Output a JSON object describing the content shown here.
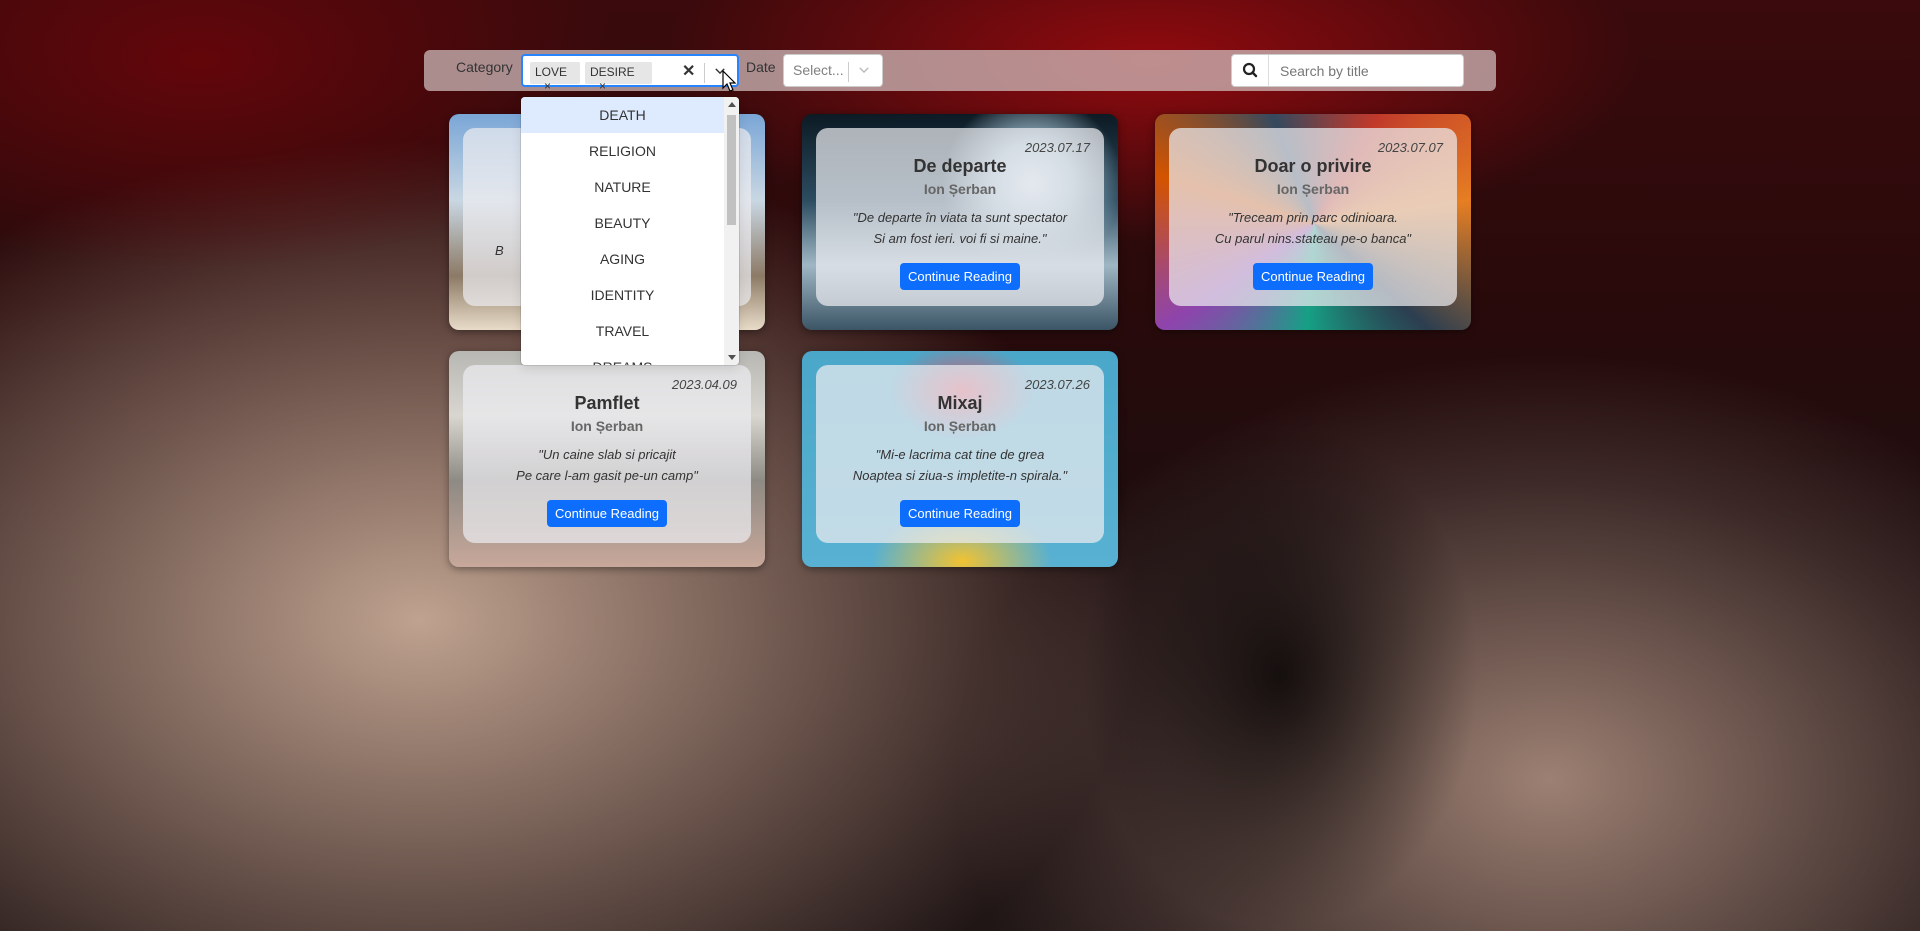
{
  "filters": {
    "category_label": "Category",
    "selected_chips": [
      {
        "label": "LOVE",
        "remove": "×"
      },
      {
        "label": "DESIRE",
        "remove": "×"
      }
    ],
    "clear_symbol": "✕",
    "date_label": "Date",
    "date_placeholder": "Select...",
    "search_placeholder": "Search by title"
  },
  "dropdown": {
    "options": [
      "DEATH",
      "RELIGION",
      "NATURE",
      "BEAUTY",
      "AGING",
      "IDENTITY",
      "TRAVEL",
      "DREAMS"
    ],
    "highlighted": "DEATH"
  },
  "cards": [
    {
      "title": "",
      "author": "",
      "date": "",
      "quote_line1": "",
      "quote_line2": "B",
      "button": ""
    },
    {
      "title": "De departe",
      "author": "Ion Șerban",
      "date": "2023.07.17",
      "quote_line1": "\"De departe în viata ta sunt spectator",
      "quote_line2": "Si am fost ieri. voi fi si maine.\"",
      "button": "Continue Reading"
    },
    {
      "title": "Doar o privire",
      "author": "Ion Șerban",
      "date": "2023.07.07",
      "quote_line1": "\"Treceam prin parc odinioara.",
      "quote_line2": "Cu parul nins.stateau pe-o banca\"",
      "button": "Continue Reading"
    },
    {
      "title": "Pamflet",
      "author": "Ion Șerban",
      "date": "2023.04.09",
      "quote_line1": "\"Un caine slab si pricajit",
      "quote_line2": "Pe care l-am gasit pe-un camp\"",
      "button": "Continue Reading"
    },
    {
      "title": "Mixaj",
      "author": "Ion Șerban",
      "date": "2023.07.26",
      "quote_line1": "\"Mi-e lacrima cat tine de grea",
      "quote_line2": "Noaptea si ziua-s impletite-n spirala.\"",
      "button": "Continue Reading"
    }
  ]
}
